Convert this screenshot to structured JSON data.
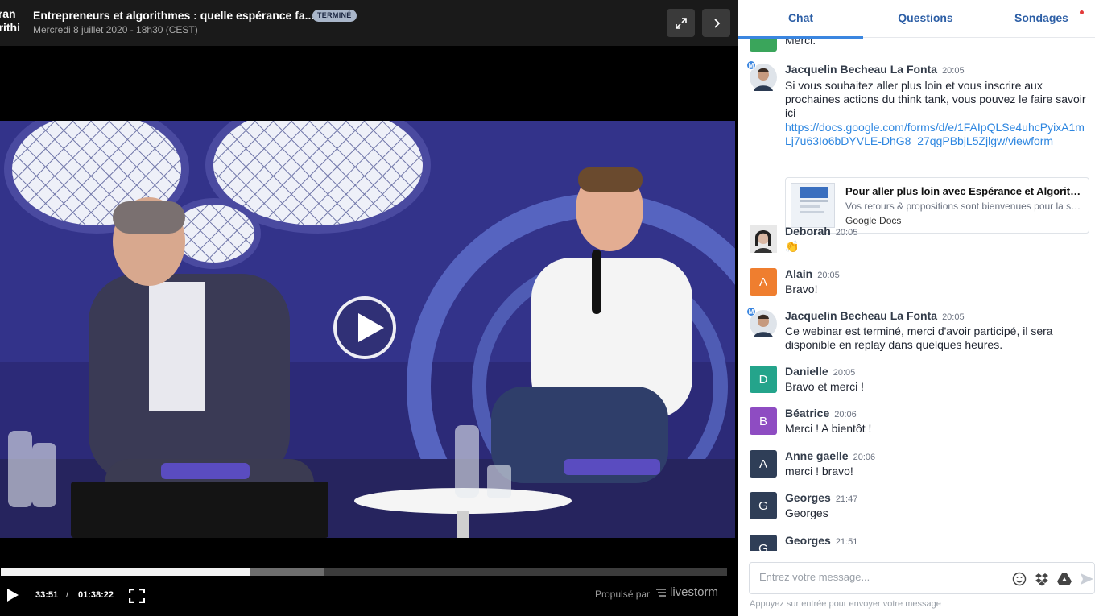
{
  "player": {
    "logo_line1": "éran",
    "logo_line2": "orithi",
    "title": "Entrepreneurs et algorithmes : quelle espérance fa...",
    "status_badge": "TERMINÉ",
    "date": "Mercredi 8 juillet 2020 - 18h30 (CEST)",
    "progress_fraction": 0.343,
    "buffered_fraction": 0.446,
    "time_current": "33:51",
    "time_separator": "/",
    "time_total": "01:38:22",
    "powered_by": "Propulsé par",
    "brand": "livestorm"
  },
  "chat": {
    "tabs": [
      {
        "label": "Chat",
        "active": true
      },
      {
        "label": "Questions",
        "active": false
      },
      {
        "label": "Sondages",
        "active": false,
        "has_notification": true
      }
    ],
    "messages": [
      {
        "text": "Merci."
      },
      {
        "author": "Jacquelin Becheau La Fonta",
        "time": "20:05",
        "moderator_badge": "M",
        "text": "Si vous souhaitez aller plus loin et vous inscrire aux prochaines actions du think tank, vous pouvez le faire savoir ici",
        "link": "https://docs.google.com/forms/d/e/1FAIpQLSe4uhcPyixA1mLj7u63Io6bDYVLE-DhG8_27qgPBbjL5Zjlgw/viewform",
        "preview": {
          "title": "Pour aller plus loin avec Espérance et Algorithmes",
          "description": "Vos retours & propositions sont bienvenues pour la suite",
          "site": "Google Docs"
        }
      },
      {
        "author": "Deborah",
        "time": "20:05",
        "text": "👏"
      },
      {
        "author": "Alain",
        "time": "20:05",
        "initial": "A",
        "text": "Bravo!"
      },
      {
        "author": "Jacquelin Becheau La Fonta",
        "time": "20:05",
        "moderator_badge": "M",
        "text": "Ce webinar est terminé, merci d'avoir participé, il sera disponible en replay dans quelques heures."
      },
      {
        "author": "Danielle",
        "time": "20:05",
        "initial": "D",
        "text": "Bravo et merci !"
      },
      {
        "author": "Béatrice",
        "time": "20:06",
        "initial": "B",
        "text": "Merci ! A bientôt !"
      },
      {
        "author": "Anne gaelle",
        "time": "20:06",
        "initial": "A",
        "text": "merci ! bravo!"
      },
      {
        "author": "Georges",
        "time": "21:47",
        "initial": "G",
        "text": "Georges"
      },
      {
        "author": "Georges",
        "time": "21:51",
        "initial": "G"
      }
    ],
    "composer": {
      "placeholder": "Entrez votre message...",
      "hint": "Appuyez sur entrée pour envoyer votre message"
    }
  },
  "colors": {
    "accent": "#3b86e0",
    "link": "#2d86e0",
    "avatar_alain": "#ef7e2f",
    "avatar_danielle": "#24a48b",
    "avatar_beatrice": "#8e4cc2",
    "avatar_annegaelle": "#2f3e57",
    "avatar_georges": "#2f3e57",
    "avatar_first": "#3aa55b"
  }
}
